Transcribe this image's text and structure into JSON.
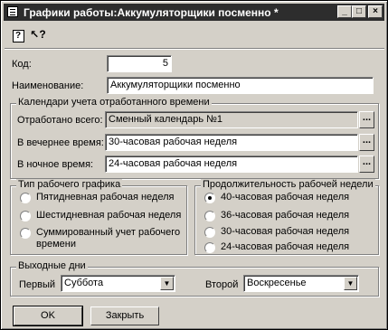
{
  "window": {
    "title": "Графики работы:Аккумуляторщики посменно *",
    "controls": {
      "minimize": "_",
      "maximize": "□",
      "close": "×"
    }
  },
  "toolbar": {
    "help_icon": "?",
    "whatsthis_icon": "↖?"
  },
  "form": {
    "code_label": "Код:",
    "code_value": "5",
    "name_label": "Наименование:",
    "name_value": "Аккумуляторщики посменно"
  },
  "calendars": {
    "title": "Календари учета отработанного времени",
    "rows": [
      {
        "label": "Отработано всего:",
        "value": "Сменный календарь №1",
        "readonly": true
      },
      {
        "label": "В вечернее время:",
        "value": "30-часовая рабочая неделя",
        "readonly": false
      },
      {
        "label": "В ночное время:",
        "value": "24-часовая рабочая неделя",
        "readonly": false
      }
    ],
    "button_label": "..."
  },
  "schedule_type": {
    "title": "Тип рабочего графика",
    "options": [
      {
        "label": "Пятидневная рабочая неделя",
        "selected": false
      },
      {
        "label": "Шестидневная рабочая неделя",
        "selected": false
      },
      {
        "label": "Суммированный учет рабочего",
        "label2": "времени",
        "selected": false
      }
    ]
  },
  "week_length": {
    "title": "Продолжительность рабочей недели",
    "options": [
      {
        "label": "40-часовая рабочая неделя",
        "selected": true
      },
      {
        "label": "36-часовая рабочая неделя",
        "selected": false
      },
      {
        "label": "30-часовая рабочая неделя",
        "selected": false
      },
      {
        "label": "24-часовая рабочая неделя",
        "selected": false
      }
    ]
  },
  "days_off": {
    "title": "Выходные дни",
    "first_label": "Первый",
    "first_value": "Суббота",
    "second_label": "Второй",
    "second_value": "Воскресенье",
    "arrow": "▼"
  },
  "buttons": {
    "ok": "OK",
    "close": "Закрыть"
  }
}
